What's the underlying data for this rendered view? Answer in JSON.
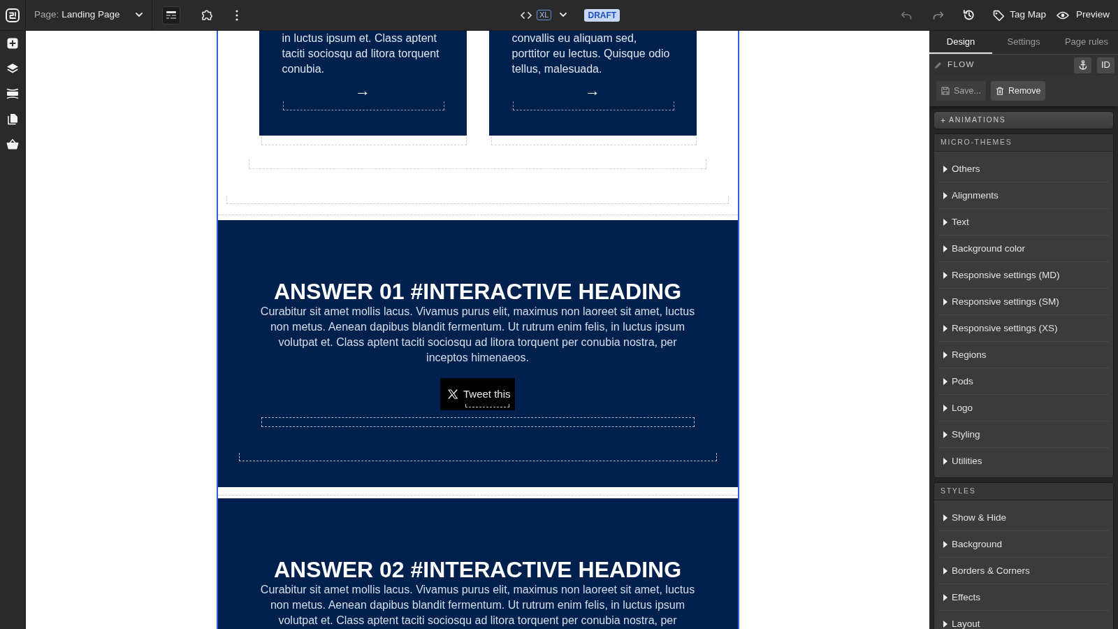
{
  "top_bar": {
    "page_selector": {
      "prefix": "Page:",
      "value": "Landing Page"
    },
    "breakpoint": "XL",
    "status_badge": "DRAFT",
    "undo": {
      "disabled": true
    },
    "redo": {
      "disabled": true
    },
    "actions": [
      {
        "label": "Tag Map"
      },
      {
        "label": "Preview"
      }
    ]
  },
  "canvas": {
    "cards": [
      {
        "text": "in luctus ipsum et. Class aptent taciti sociosqu ad litora torquent conubia.",
        "arrow": "→"
      },
      {
        "text": "convallis eu aliquam sed, porttitor eu lectus. Quisque odio tellus, malesuada.",
        "arrow": "→"
      }
    ],
    "sections": [
      {
        "heading": "ANSWER 01 #INTERACTIVE HEADING",
        "body": "Curabitur sit amet mollis lacus. Vivamus purus elit, maximus non laoreet sit amet, luctus non metus. Aenean dapibus blandit fermentum. Ut rutrum enim felis, in luctus ipsum volutpat et. Class aptent taciti sociosqu ad litora torquent per conubia nostra, per inceptos himenaeos.",
        "share_button": "Tweet this"
      },
      {
        "heading": "ANSWER 02 #INTERACTIVE HEADING",
        "body": "Curabitur sit amet mollis lacus. Vivamus purus elit, maximus non laoreet sit amet, luctus non metus. Aenean dapibus blandit fermentum. Ut rutrum enim felis, in luctus ipsum volutpat et. Class aptent taciti sociosqu ad litora torquent per conubia nostra, per"
      }
    ]
  },
  "panel": {
    "tabs": [
      {
        "label": "Design",
        "selected": true
      },
      {
        "label": "Settings",
        "selected": false
      },
      {
        "label": "Page rules",
        "selected": false
      }
    ],
    "element": {
      "name": "FLOW",
      "id_button": "ID"
    },
    "buttons": [
      {
        "label": "Save...",
        "disabled": true
      },
      {
        "label": "Remove",
        "disabled": false
      }
    ],
    "animations": "ANIMATIONS",
    "groups": [
      {
        "title": "MICRO-THEMES",
        "items": [
          {
            "label": "Others",
            "expanded": false
          },
          {
            "label": "Alignments",
            "expanded": false
          },
          {
            "label": "Text",
            "expanded": false
          },
          {
            "label": "Background color",
            "expanded": false
          },
          {
            "label": "Responsive settings (MD)",
            "expanded": false
          },
          {
            "label": "Responsive settings (SM)",
            "expanded": false
          },
          {
            "label": "Responsive settings (XS)",
            "expanded": false
          },
          {
            "label": "Regions",
            "expanded": false
          },
          {
            "label": "Pods",
            "expanded": false
          },
          {
            "label": "Logo",
            "expanded": false
          },
          {
            "label": "Styling",
            "expanded": false
          },
          {
            "label": "Utilities",
            "expanded": false
          }
        ]
      },
      {
        "title": "STYLES",
        "items": [
          {
            "label": "Show & Hide",
            "expanded": false
          },
          {
            "label": "Background",
            "expanded": false
          },
          {
            "label": "Borders & Corners",
            "expanded": false
          },
          {
            "label": "Effects",
            "expanded": false
          },
          {
            "label": "Layout",
            "expanded": false
          }
        ]
      }
    ]
  }
}
